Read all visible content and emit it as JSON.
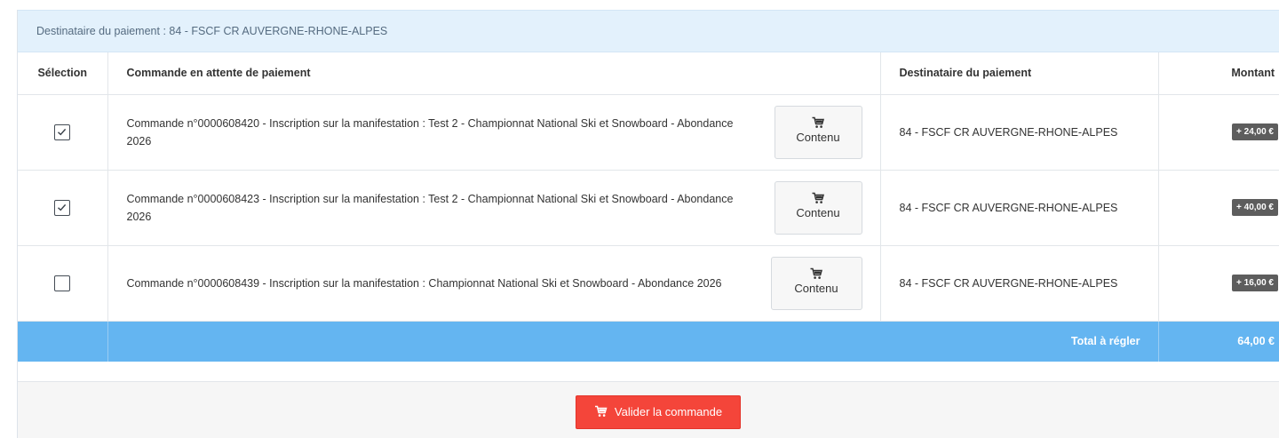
{
  "panel": {
    "title": "Destinataire du paiement : 84 - FSCF CR AUVERGNE-RHONE-ALPES"
  },
  "table": {
    "headers": {
      "selection": "Sélection",
      "commande": "Commande en attente de paiement",
      "destinataire": "Destinataire du paiement",
      "montant": "Montant"
    },
    "rows": [
      {
        "checked": true,
        "commande": "Commande n°0000608420 - Inscription sur la manifestation : Test 2 - Championnat National Ski et Snowboard - Abondance 2026",
        "contenu_label": "Contenu",
        "destinataire": "84 - FSCF CR AUVERGNE-RHONE-ALPES",
        "montant": "+ 24,00 €"
      },
      {
        "checked": true,
        "commande": "Commande n°0000608423 - Inscription sur la manifestation : Test 2 - Championnat National Ski et Snowboard - Abondance 2026",
        "contenu_label": "Contenu",
        "destinataire": "84 - FSCF CR AUVERGNE-RHONE-ALPES",
        "montant": "+ 40,00 €"
      },
      {
        "checked": false,
        "commande": "Commande n°0000608439 - Inscription sur la manifestation : Championnat National Ski et Snowboard - Abondance 2026",
        "contenu_label": "Contenu",
        "destinataire": "84 - FSCF CR AUVERGNE-RHONE-ALPES",
        "montant": "+ 16,00 €"
      }
    ],
    "total_label": "Total à régler",
    "total_value": "64,00 €"
  },
  "footer": {
    "valider_label": "Valider la commande"
  },
  "icons": {
    "cart": "cart-icon",
    "check": "checkmark-icon"
  },
  "colors": {
    "header_bg": "#e3f1fc",
    "total_bg": "#64b5f1",
    "badge_bg": "#5d5d5d",
    "valider_bg": "#f4453a"
  }
}
